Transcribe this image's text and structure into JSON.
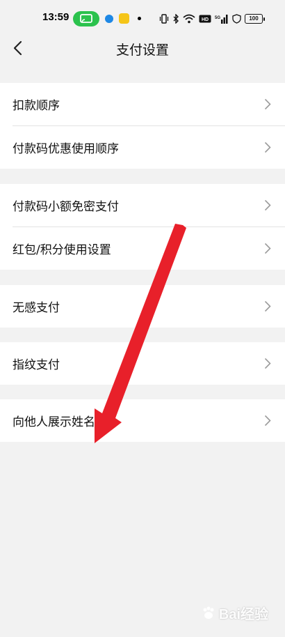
{
  "status_bar": {
    "time": "13:59",
    "battery": "100"
  },
  "header": {
    "title": "支付设置"
  },
  "groups": [
    {
      "items": [
        {
          "label": "扣款顺序"
        },
        {
          "label": "付款码优惠使用顺序"
        }
      ]
    },
    {
      "items": [
        {
          "label": "付款码小额免密支付"
        },
        {
          "label": "红包/积分使用设置"
        }
      ]
    },
    {
      "items": [
        {
          "label": "无感支付"
        }
      ]
    },
    {
      "items": [
        {
          "label": "指纹支付"
        }
      ]
    },
    {
      "items": [
        {
          "label": "向他人展示姓名"
        }
      ]
    }
  ],
  "icons": {
    "back": "chevron-left-icon",
    "row_chevron": "chevron-right-icon",
    "cast": "screen-cast-icon",
    "vibrate": "vibrate-icon",
    "bluetooth": "bluetooth-icon",
    "wifi": "wifi-icon",
    "signal": "signal-icon"
  },
  "colors": {
    "background": "#f2f2f2",
    "row_background": "#ffffff",
    "cast_pill": "#2bc24d",
    "annotation_arrow": "#e8202a"
  },
  "watermark": {
    "text": "Bai经验"
  }
}
